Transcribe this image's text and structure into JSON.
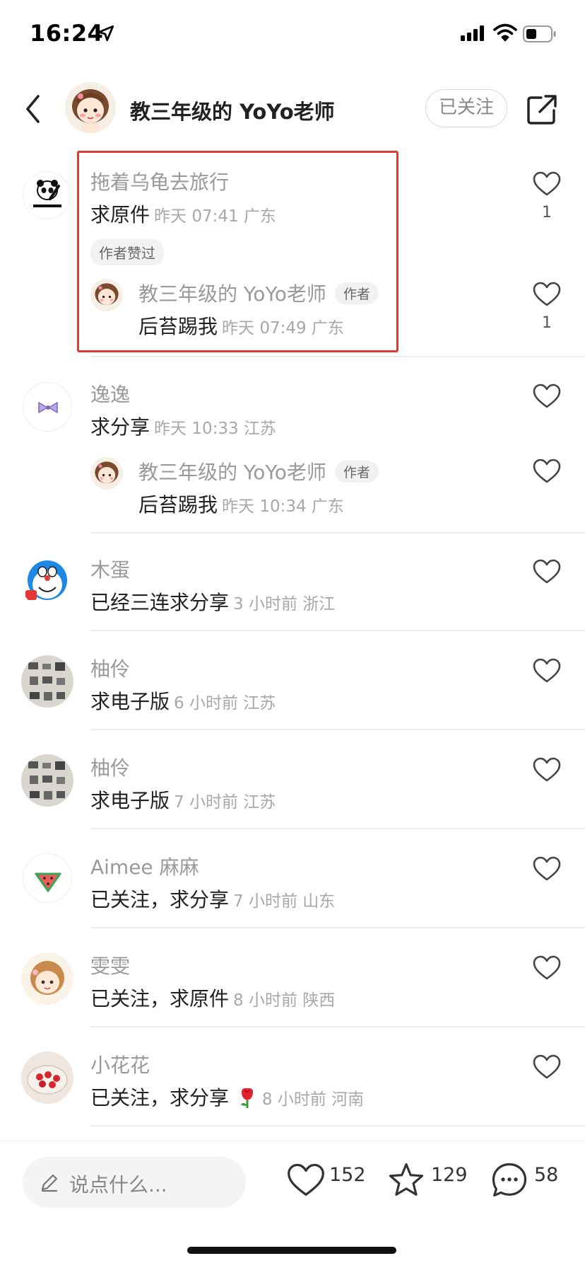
{
  "status_bar": {
    "time": "16:24"
  },
  "header": {
    "title": "教三年级的 YoYo老师",
    "follow_label": "已关注"
  },
  "comments": [
    {
      "nickname": "拖着乌龟去旅行",
      "text": "求原件",
      "meta": "昨天 07:41 广东",
      "badge": "作者赞过",
      "likes": "1",
      "reply": {
        "nickname": "教三年级的 YoYo老师",
        "tag": "作者",
        "text": "后苔踢我",
        "meta": "昨天 07:49 广东",
        "likes": "1"
      }
    },
    {
      "nickname": "逸逸",
      "text": "求分享",
      "meta": "昨天 10:33 江苏",
      "reply": {
        "nickname": "教三年级的 YoYo老师",
        "tag": "作者",
        "text": "后苔踢我",
        "meta": "昨天 10:34 广东"
      }
    },
    {
      "nickname": "木蛋",
      "text": "已经三连求分享",
      "meta": "3 小时前 浙江"
    },
    {
      "nickname": "柚伶",
      "text": "求电子版",
      "meta": "6 小时前 江苏"
    },
    {
      "nickname": "柚伶",
      "text": "求电子版",
      "meta": "7 小时前 江苏"
    },
    {
      "nickname": "Aimee 麻麻",
      "text": "已关注，求分享",
      "meta": "7 小时前 山东"
    },
    {
      "nickname": "雯雯",
      "text": "已关注，求原件",
      "meta": "8 小时前 陕西"
    },
    {
      "nickname": "小花花",
      "text": "已关注，求分享",
      "meta": "8 小时前 河南"
    }
  ],
  "bottom_bar": {
    "input_placeholder": "说点什么...",
    "likes": "152",
    "stars": "129",
    "comments": "58"
  },
  "icons": [
    "location-arrow-icon",
    "signal-icon",
    "wifi-icon",
    "battery-icon",
    "back-arrow-icon",
    "share-icon",
    "heart-icon",
    "star-icon",
    "comment-bubble-icon",
    "pencil-icon",
    "rose-emoji-icon"
  ],
  "colors": {
    "highlight_border": "#e03b33",
    "muted_text": "#9a9a9a"
  }
}
